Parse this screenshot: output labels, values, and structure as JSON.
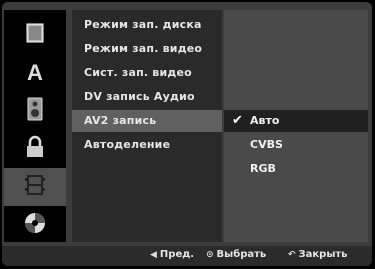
{
  "sidebar": {
    "items": [
      {
        "icon": "disc-icon"
      },
      {
        "icon": "language-icon"
      },
      {
        "icon": "speaker-icon"
      },
      {
        "icon": "lock-icon"
      },
      {
        "icon": "film-icon"
      },
      {
        "icon": "dvd-disc-icon"
      }
    ],
    "active_index": 4
  },
  "menu": {
    "items": [
      {
        "label": "Режим зап. диска"
      },
      {
        "label": "Режим зап. видео"
      },
      {
        "label": "Сист. зап. видео"
      },
      {
        "label": "DV запись Аудио"
      },
      {
        "label": "AV2 запись"
      },
      {
        "label": "Автоделение"
      }
    ],
    "active_index": 4
  },
  "submenu": {
    "items": [
      {
        "label": "Авто",
        "checked": true
      },
      {
        "label": "CVBS",
        "checked": false
      },
      {
        "label": "RGB",
        "checked": false
      }
    ],
    "active_index": 0
  },
  "footer": {
    "prev_label": "Пред.",
    "select_label": "Выбрать",
    "close_label": "Закрыть"
  },
  "colors": {
    "background": "#000000",
    "panel": "#3c3c3c",
    "highlight": "#606060"
  }
}
